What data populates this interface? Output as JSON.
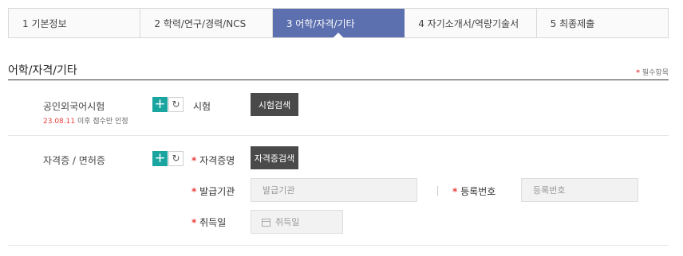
{
  "steps": [
    {
      "label": "1  기본정보"
    },
    {
      "label": "2  학력/연구/경력/NCS"
    },
    {
      "label": "3  어학/자격/기타"
    },
    {
      "label": "4  자기소개서/역량기술서"
    },
    {
      "label": "5  최종제출"
    }
  ],
  "active_step": 2,
  "section": {
    "title": "어학/자격/기타",
    "required_note": "필수항목"
  },
  "language": {
    "label": "공인외국어시험",
    "note_date": "23.08.11",
    "note_text": " 이후 점수만 인정",
    "field_label": "시험",
    "search_button": "시험검색"
  },
  "license": {
    "label": "자격증 / 면허증",
    "cert_label": "자격증명",
    "search_button": "자격증검색",
    "issuer_label": "발급기관",
    "issuer_placeholder": "발급기관",
    "regno_label": "등록번호",
    "regno_placeholder": "등록번호",
    "date_label": "취득일",
    "date_placeholder": "취득일"
  },
  "icons": {
    "add": "+",
    "reset": "↻",
    "calendar": "calendar-icon"
  },
  "colors": {
    "active_tab": "#5c6fae",
    "add_button": "#1aa5a0",
    "required_star": "#e8413b",
    "dark_button": "#4a4a4a"
  }
}
